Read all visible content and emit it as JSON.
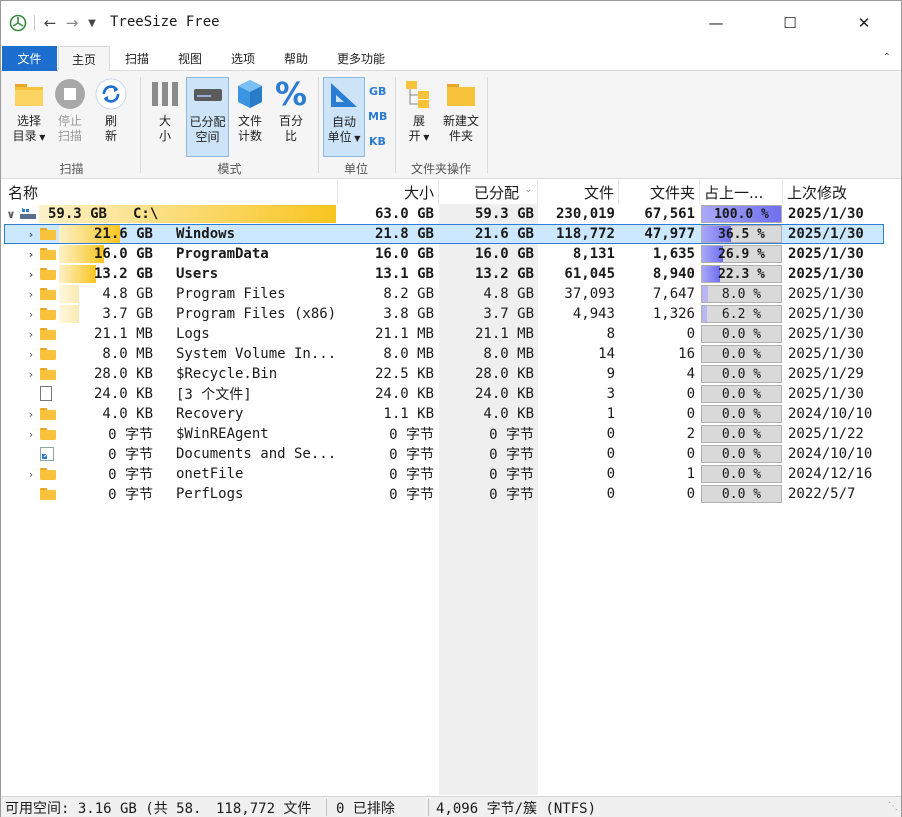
{
  "window": {
    "title": "TreeSize Free",
    "minimize": "—",
    "maximize": "☐",
    "close": "✕"
  },
  "tabs": [
    {
      "label": "文件"
    },
    {
      "label": "主页"
    },
    {
      "label": "扫描"
    },
    {
      "label": "视图"
    },
    {
      "label": "选项"
    },
    {
      "label": "帮助"
    },
    {
      "label": "更多功能"
    }
  ],
  "ribbon": {
    "scan_group": "扫描",
    "mode_group": "模式",
    "unit_group": "单位",
    "folder_group": "文件夹操作",
    "select_dir": [
      "选择",
      "目录"
    ],
    "stop_scan": [
      "停止",
      "扫描"
    ],
    "refresh": [
      "刷",
      "新"
    ],
    "size": [
      "大",
      "小"
    ],
    "allocated": [
      "已分配",
      "空间"
    ],
    "file_count": [
      "文件",
      "计数"
    ],
    "percent": [
      "百分",
      "比"
    ],
    "auto_unit": [
      "自动",
      "单位"
    ],
    "gb": "GB",
    "mb": "MB",
    "kb": "KB",
    "expand": [
      "展",
      "开"
    ],
    "new_folder": [
      "新建文",
      "件夹"
    ]
  },
  "columns": {
    "name": "名称",
    "size": "大小",
    "allocated": "已分配",
    "files": "文件",
    "folders": "文件夹",
    "percent": "占上一...",
    "modified": "上次修改"
  },
  "colors": {
    "accent": "#1d6fcf",
    "selection": "#cce8ff",
    "bar_strong": "#f9c51f",
    "bar_light": "#fbe9b0",
    "pct_fill": "#6f6ff0"
  },
  "rows": [
    {
      "name_size": "59.3 GB",
      "name": "C:\\",
      "size": "63.0 GB",
      "allocated": "59.3 GB",
      "files": "230,019",
      "folders": "67,561",
      "percent": "100.0 %",
      "pct": 100.0,
      "modified": "2025/1/30",
      "icon": "drive-icon",
      "expander": "collapse",
      "level": 0,
      "bold": true,
      "share": 1.0
    },
    {
      "name_size": "21.6 GB",
      "name": "Windows",
      "size": "21.8 GB",
      "allocated": "21.6 GB",
      "files": "118,772",
      "folders": "47,977",
      "percent": "36.5 %",
      "pct": 36.5,
      "modified": "2025/1/30",
      "icon": "folder-icon",
      "expander": "expand",
      "level": 1,
      "bold": true,
      "selected": true,
      "share": 0.365
    },
    {
      "name_size": "16.0 GB",
      "name": "ProgramData",
      "size": "16.0 GB",
      "allocated": "16.0 GB",
      "files": "8,131",
      "folders": "1,635",
      "percent": "26.9 %",
      "pct": 26.9,
      "modified": "2025/1/30",
      "icon": "folder-icon",
      "expander": "expand",
      "level": 1,
      "bold": true,
      "share": 0.269
    },
    {
      "name_size": "13.2 GB",
      "name": "Users",
      "size": "13.1 GB",
      "allocated": "13.2 GB",
      "files": "61,045",
      "folders": "8,940",
      "percent": "22.3 %",
      "pct": 22.3,
      "modified": "2025/1/30",
      "icon": "folder-icon",
      "expander": "expand",
      "level": 1,
      "bold": true,
      "share": 0.223
    },
    {
      "name_size": "4.8 GB",
      "name": "Program Files",
      "size": "8.2 GB",
      "allocated": "4.8 GB",
      "files": "37,093",
      "folders": "7,647",
      "percent": "8.0 %",
      "pct": 8.0,
      "modified": "2025/1/30",
      "icon": "folder-icon",
      "expander": "expand",
      "level": 1,
      "bold": false,
      "share": 0.08
    },
    {
      "name_size": "3.7 GB",
      "name": "Program Files (x86)",
      "size": "3.8 GB",
      "allocated": "3.7 GB",
      "files": "4,943",
      "folders": "1,326",
      "percent": "6.2 %",
      "pct": 6.2,
      "modified": "2025/1/30",
      "icon": "folder-icon",
      "expander": "expand",
      "level": 1,
      "bold": false,
      "share": 0.062
    },
    {
      "name_size": "21.1 MB",
      "name": "Logs",
      "size": "21.1 MB",
      "allocated": "21.1 MB",
      "files": "8",
      "folders": "0",
      "percent": "0.0 %",
      "pct": 0.0,
      "modified": "2025/1/30",
      "icon": "folder-icon",
      "expander": "expand",
      "level": 1,
      "bold": false,
      "share": 0
    },
    {
      "name_size": "8.0 MB",
      "name": "System Volume In...",
      "size": "8.0 MB",
      "allocated": "8.0 MB",
      "files": "14",
      "folders": "16",
      "percent": "0.0 %",
      "pct": 0.0,
      "modified": "2025/1/30",
      "icon": "folder-icon",
      "expander": "expand",
      "level": 1,
      "bold": false,
      "share": 0
    },
    {
      "name_size": "28.0 KB",
      "name": "$Recycle.Bin",
      "size": "22.5 KB",
      "allocated": "28.0 KB",
      "files": "9",
      "folders": "4",
      "percent": "0.0 %",
      "pct": 0.0,
      "modified": "2025/1/29",
      "icon": "folder-icon",
      "expander": "expand",
      "level": 1,
      "bold": false,
      "share": 0
    },
    {
      "name_size": "24.0 KB",
      "name": "[3 个文件]",
      "size": "24.0 KB",
      "allocated": "24.0 KB",
      "files": "3",
      "folders": "0",
      "percent": "0.0 %",
      "pct": 0.0,
      "modified": "2025/1/30",
      "icon": "file-icon",
      "expander": "none",
      "level": 1,
      "bold": false,
      "share": 0
    },
    {
      "name_size": "4.0 KB",
      "name": "Recovery",
      "size": "1.1 KB",
      "allocated": "4.0 KB",
      "files": "1",
      "folders": "0",
      "percent": "0.0 %",
      "pct": 0.0,
      "modified": "2024/10/10",
      "icon": "folder-icon",
      "expander": "expand",
      "level": 1,
      "bold": false,
      "share": 0
    },
    {
      "name_size": "0 字节",
      "name": "$WinREAgent",
      "size": "0 字节",
      "allocated": "0 字节",
      "files": "0",
      "folders": "2",
      "percent": "0.0 %",
      "pct": 0.0,
      "modified": "2025/1/22",
      "icon": "folder-icon",
      "expander": "expand",
      "level": 1,
      "bold": false,
      "share": 0
    },
    {
      "name_size": "0 字节",
      "name": "Documents and Se...",
      "size": "0 字节",
      "allocated": "0 字节",
      "files": "0",
      "folders": "0",
      "percent": "0.0 %",
      "pct": 0.0,
      "modified": "2024/10/10",
      "icon": "shortcut-icon",
      "expander": "none",
      "level": 1,
      "bold": false,
      "share": 0
    },
    {
      "name_size": "0 字节",
      "name": "onetFile",
      "size": "0 字节",
      "allocated": "0 字节",
      "files": "0",
      "folders": "1",
      "percent": "0.0 %",
      "pct": 0.0,
      "modified": "2024/12/16",
      "icon": "folder-icon",
      "expander": "expand",
      "level": 1,
      "bold": false,
      "share": 0
    },
    {
      "name_size": "0 字节",
      "name": "PerfLogs",
      "size": "0 字节",
      "allocated": "0 字节",
      "files": "0",
      "folders": "0",
      "percent": "0.0 %",
      "pct": 0.0,
      "modified": "2022/5/7",
      "icon": "folder-icon",
      "expander": "none",
      "level": 1,
      "bold": false,
      "share": 0
    }
  ],
  "status": {
    "free_space": "可用空间: 3.16 GB  (共 58.",
    "files": "118,772 文件",
    "excluded": "0 已排除",
    "cluster": "4,096 字节/簇 (NTFS)"
  }
}
